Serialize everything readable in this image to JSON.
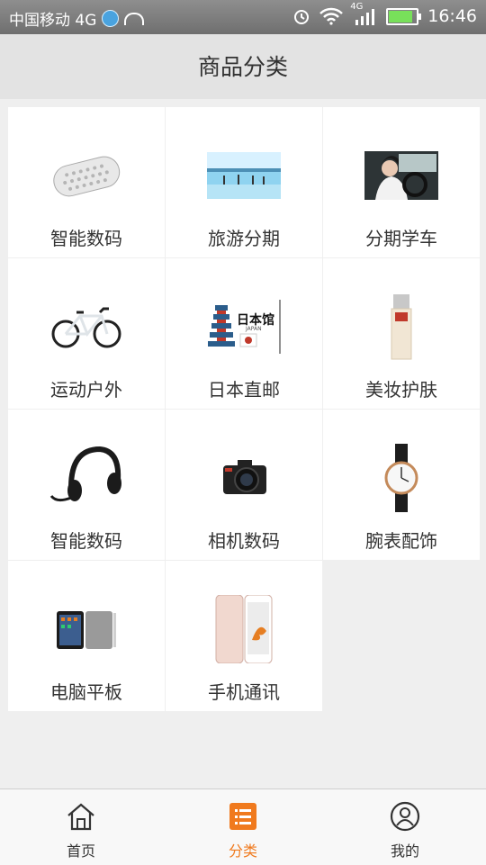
{
  "status": {
    "carrier": "中国移动 4G",
    "network": "4G",
    "time": "16:46"
  },
  "header": {
    "title": "商品分类"
  },
  "categories": [
    {
      "label": "智能数码",
      "icon": "speaker-image"
    },
    {
      "label": "旅游分期",
      "icon": "beach-image"
    },
    {
      "label": "分期学车",
      "icon": "driving-image"
    },
    {
      "label": "运动户外",
      "icon": "bicycle-image"
    },
    {
      "label": "日本直邮",
      "icon": "japan-mail-image",
      "image_text": "日本馆",
      "image_subtext": "JAPAN"
    },
    {
      "label": "美妆护肤",
      "icon": "cosmetics-bottle-image"
    },
    {
      "label": "智能数码",
      "icon": "headphones-image"
    },
    {
      "label": "相机数码",
      "icon": "camera-image"
    },
    {
      "label": "腕表配饰",
      "icon": "watch-image"
    },
    {
      "label": "电脑平板",
      "icon": "tablet-image"
    },
    {
      "label": "手机通讯",
      "icon": "phone-image"
    }
  ],
  "nav": [
    {
      "label": "首页",
      "icon": "home-icon",
      "active": false
    },
    {
      "label": "分类",
      "icon": "list-icon",
      "active": true
    },
    {
      "label": "我的",
      "icon": "profile-icon",
      "active": false
    }
  ],
  "colors": {
    "accent": "#f07a1e",
    "title_bg": "#e3e3e3",
    "page_bg": "#efefef"
  }
}
